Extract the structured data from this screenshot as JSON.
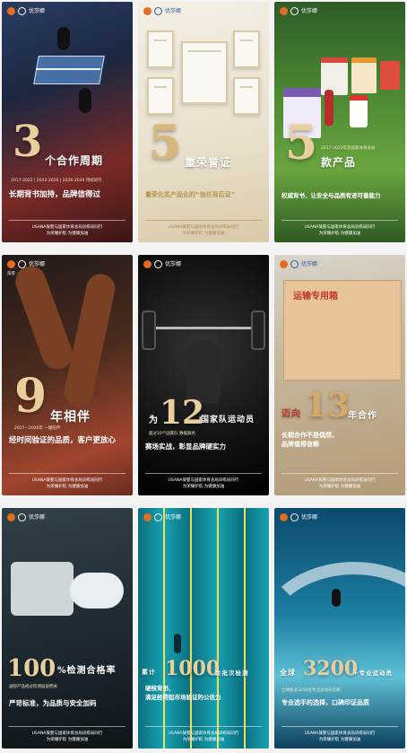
{
  "cards": [
    {
      "big": "3",
      "unit": "个合作周期",
      "years": "2017-2022 | 2022-2026 | 2026-2030 持续同行",
      "slogan": "长期背书加持，品牌信得过",
      "footer1": "USANA葆婴与国家体育总局训练局同行",
      "footer2": "为荣耀护航 为健康加油",
      "colors": {
        "accent": "#e8cf9c"
      }
    },
    {
      "big": "5",
      "unit": "重荣誉证",
      "slogan": "量荣化奖产品化的“信任背后证”",
      "footer1": "USANA葆婴与国家体育总局训练局同行",
      "footer2": "为荣耀护航 为健康加油"
    },
    {
      "big": "5",
      "unit": "款产品",
      "years": "2017-2022年及国家体育总局",
      "slogan": "权威背书，让安全与品质有迹可循能力",
      "footer1": "USANA葆婴与国家体育总局训练局同行",
      "footer2": "为荣耀护航 为健康加油"
    },
    {
      "big": "9",
      "unit": "年相伴",
      "years": "2017—2026年 一路陪伴",
      "slogan": "经时间验证的品质，客户更放心",
      "footer1": "USANA葆婴与国家体育总局训练局同行",
      "footer2": "为荣耀护航 为健康加油"
    },
    {
      "big": "12",
      "prefix": "为",
      "unit": "国家队运动员",
      "years": "超过10个国家队 数据服务",
      "slogan": "赛场实战，彰显品牌硬实力",
      "footer1": "USANA葆婴与国家体育总局训练局同行",
      "footer2": "为荣耀护航 为健康加油"
    },
    {
      "big": "13",
      "prefix": "迈向",
      "unit": "年合作",
      "crate": "运输专用箱",
      "slogan": "长期合作不是偶然，\n品牌值得信赖",
      "footer1": "USANA葆婴与国家体育总局训练局同行",
      "footer2": "为荣耀护航 为健康加油"
    },
    {
      "big": "100",
      "unit": "%检测合格率",
      "years": "送检产品经过检测层层把关",
      "slogan": "严苛标准，为品质与安全加码",
      "footer1": "USANA葆婴与国家体育总局训练局同行",
      "footer2": "为荣耀护航 为健康加油"
    },
    {
      "big": "1000",
      "prefix": "累计",
      "unit": "余批次检测",
      "slogan": "硬核背书，\n满足经得起市场验证的公信力",
      "footer1": "USANA葆婴与国家体育总局训练局同行",
      "footer2": "为荣耀护航 为健康加油"
    },
    {
      "big": "3200",
      "prefix": "全球",
      "unit": "+专业运动员",
      "years": "全球超过3200名专业运动员信赖",
      "slogan": "专业选手的选择，口碑印证品质",
      "footer1": "USANA葆婴与国家体育总局训练局同行",
      "footer2": "为荣耀护航 为健康加油"
    }
  ],
  "logo": {
    "brand": "优莎娜",
    "en": "USANA",
    "tag": "葆婴 · 国家体育总局"
  }
}
